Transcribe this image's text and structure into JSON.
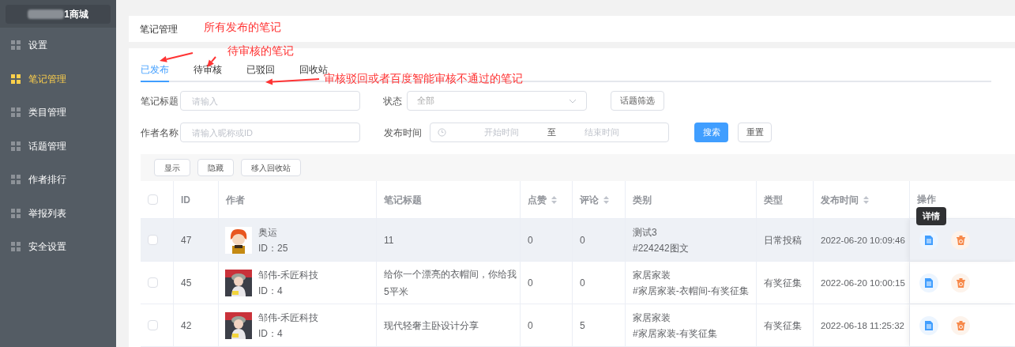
{
  "sidebar": {
    "logo": "1商城",
    "items": [
      {
        "label": "设置",
        "selected": false
      },
      {
        "label": "笔记管理",
        "selected": true
      },
      {
        "label": "类目管理",
        "selected": false
      },
      {
        "label": "话题管理",
        "selected": false
      },
      {
        "label": "作者排行",
        "selected": false
      },
      {
        "label": "举报列表",
        "selected": false
      },
      {
        "label": "安全设置",
        "selected": false
      }
    ]
  },
  "breadcrumb": "笔记管理",
  "tabs": [
    {
      "label": "已发布",
      "selected": true
    },
    {
      "label": "待审核",
      "selected": false
    },
    {
      "label": "已驳回",
      "selected": false
    },
    {
      "label": "回收站",
      "selected": false
    }
  ],
  "filters": {
    "title": {
      "label": "笔记标题",
      "placeholder": "请输入"
    },
    "status": {
      "label": "状态",
      "value": "全部"
    },
    "topic_button": "话题筛选",
    "author": {
      "label": "作者名称",
      "placeholder": "请输入昵称或ID"
    },
    "time": {
      "label": "发布时间",
      "start_placeholder": "开始时间",
      "separator": "至",
      "end_placeholder": "结束时间"
    },
    "search_button": "搜索",
    "reset_button": "重置"
  },
  "bulk_actions": [
    "显示",
    "隐藏",
    "移入回收站"
  ],
  "table": {
    "all_checked": false,
    "columns": [
      {
        "label": "ID",
        "sortable": false
      },
      {
        "label": "作者",
        "sortable": false
      },
      {
        "label": "笔记标题",
        "sortable": false
      },
      {
        "label": "点赞",
        "sortable": true
      },
      {
        "label": "评论",
        "sortable": true
      },
      {
        "label": "类别",
        "sortable": false
      },
      {
        "label": "类型",
        "sortable": false
      },
      {
        "label": "发布时间",
        "sortable": true
      },
      {
        "label": "操作",
        "sortable": false
      }
    ],
    "rows": [
      {
        "id": "47",
        "author": "奥运",
        "author_id": "ID：25",
        "title": "11",
        "likes": "0",
        "comments": "0",
        "category": "测试3",
        "topic": "#224242图文",
        "type": "日常投稿",
        "time": "2022-06-20 10:09:46",
        "checked": false,
        "hovered": true
      },
      {
        "id": "45",
        "author": "邹伟-禾匠科技",
        "author_id": "ID：4",
        "title": "给你一个漂亮的衣帽间，你给我5平米",
        "likes": "0",
        "comments": "0",
        "category": "家居家装",
        "topic": "#家居家装-衣帽间-有奖征集",
        "type": "有奖征集",
        "time": "2022-06-20 10:00:15",
        "checked": false,
        "hovered": false
      },
      {
        "id": "42",
        "author": "邹伟-禾匠科技",
        "author_id": "ID：4",
        "title": "现代轻奢主卧设计分享",
        "likes": "0",
        "comments": "5",
        "category": "家居家装",
        "topic": "#家居家装-有奖征集",
        "type": "有奖征集",
        "time": "2022-06-18 11:25:32",
        "checked": false,
        "hovered": false
      }
    ]
  },
  "tooltip": "详情",
  "annotations": [
    "所有发布的笔记",
    "待审核的笔记",
    "审核驳回或者百度智能审核不通过的笔记"
  ]
}
